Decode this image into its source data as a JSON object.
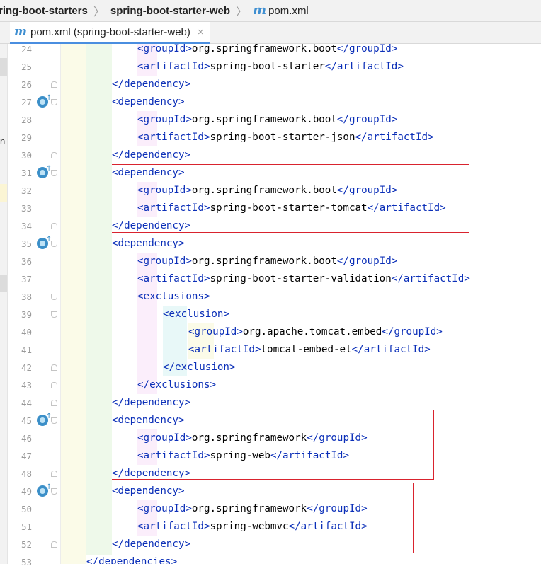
{
  "breadcrumb": {
    "items": [
      "ring-boot-starters",
      "spring-boot-starter-web"
    ],
    "file_label": "pom.xml",
    "file_icon": "maven-m-icon"
  },
  "tab": {
    "label": "pom.xml (spring-boot-starter-web)",
    "close_glyph": "×",
    "icon": "maven-m-icon"
  },
  "left_strip": {
    "visible_char": "n"
  },
  "accent_colors": {
    "tag": "#0b2fb8",
    "highlight": "#d9232e",
    "tab_underline": "#4a8ee0",
    "maven_icon": "#3f8fd1"
  },
  "editor": {
    "lines": [
      {
        "no": "24",
        "indent": 2,
        "name": "groupId",
        "kind": "pair",
        "text": "org.springframework.boot"
      },
      {
        "no": "25",
        "indent": 2,
        "name": "artifactId",
        "kind": "pair",
        "text": "spring-boot-starter"
      },
      {
        "no": "26",
        "indent": 1,
        "name": "dependency",
        "kind": "close"
      },
      {
        "no": "27",
        "indent": 1,
        "name": "dependency",
        "kind": "open"
      },
      {
        "no": "28",
        "indent": 2,
        "name": "groupId",
        "kind": "pair",
        "text": "org.springframework.boot"
      },
      {
        "no": "29",
        "indent": 2,
        "name": "artifactId",
        "kind": "pair",
        "text": "spring-boot-starter-json"
      },
      {
        "no": "30",
        "indent": 1,
        "name": "dependency",
        "kind": "close"
      },
      {
        "no": "31",
        "indent": 1,
        "name": "dependency",
        "kind": "open"
      },
      {
        "no": "32",
        "indent": 2,
        "name": "groupId",
        "kind": "pair",
        "text": "org.springframework.boot"
      },
      {
        "no": "33",
        "indent": 2,
        "name": "artifactId",
        "kind": "pair",
        "text": "spring-boot-starter-tomcat"
      },
      {
        "no": "34",
        "indent": 1,
        "name": "dependency",
        "kind": "close"
      },
      {
        "no": "35",
        "indent": 1,
        "name": "dependency",
        "kind": "open"
      },
      {
        "no": "36",
        "indent": 2,
        "name": "groupId",
        "kind": "pair",
        "text": "org.springframework.boot"
      },
      {
        "no": "37",
        "indent": 2,
        "name": "artifactId",
        "kind": "pair",
        "text": "spring-boot-starter-validation"
      },
      {
        "no": "38",
        "indent": 2,
        "name": "exclusions",
        "kind": "open"
      },
      {
        "no": "39",
        "indent": 3,
        "name": "exclusion",
        "kind": "open"
      },
      {
        "no": "40",
        "indent": 4,
        "name": "groupId",
        "kind": "pair",
        "text": "org.apache.tomcat.embed"
      },
      {
        "no": "41",
        "indent": 4,
        "name": "artifactId",
        "kind": "pair",
        "text": "tomcat-embed-el"
      },
      {
        "no": "42",
        "indent": 3,
        "name": "exclusion",
        "kind": "close"
      },
      {
        "no": "43",
        "indent": 2,
        "name": "exclusions",
        "kind": "close"
      },
      {
        "no": "44",
        "indent": 1,
        "name": "dependency",
        "kind": "close"
      },
      {
        "no": "45",
        "indent": 1,
        "name": "dependency",
        "kind": "open"
      },
      {
        "no": "46",
        "indent": 2,
        "name": "groupId",
        "kind": "pair",
        "text": "org.springframework"
      },
      {
        "no": "47",
        "indent": 2,
        "name": "artifactId",
        "kind": "pair",
        "text": "spring-web"
      },
      {
        "no": "48",
        "indent": 1,
        "name": "dependency",
        "kind": "close"
      },
      {
        "no": "49",
        "indent": 1,
        "name": "dependency",
        "kind": "open"
      },
      {
        "no": "50",
        "indent": 2,
        "name": "groupId",
        "kind": "pair",
        "text": "org.springframework"
      },
      {
        "no": "51",
        "indent": 2,
        "name": "artifactId",
        "kind": "pair",
        "text": "spring-webmvc"
      },
      {
        "no": "52",
        "indent": 1,
        "name": "dependency",
        "kind": "close"
      },
      {
        "no": "53",
        "indent": 0,
        "name": "dependencies",
        "kind": "close"
      }
    ],
    "gutter_icons": [
      "27",
      "31",
      "35",
      "45",
      "49"
    ],
    "fold_open": [
      "27",
      "31",
      "35",
      "38",
      "39",
      "45",
      "49"
    ],
    "fold_close": [
      "26",
      "30",
      "34",
      "42",
      "43",
      "44",
      "48",
      "52"
    ]
  }
}
